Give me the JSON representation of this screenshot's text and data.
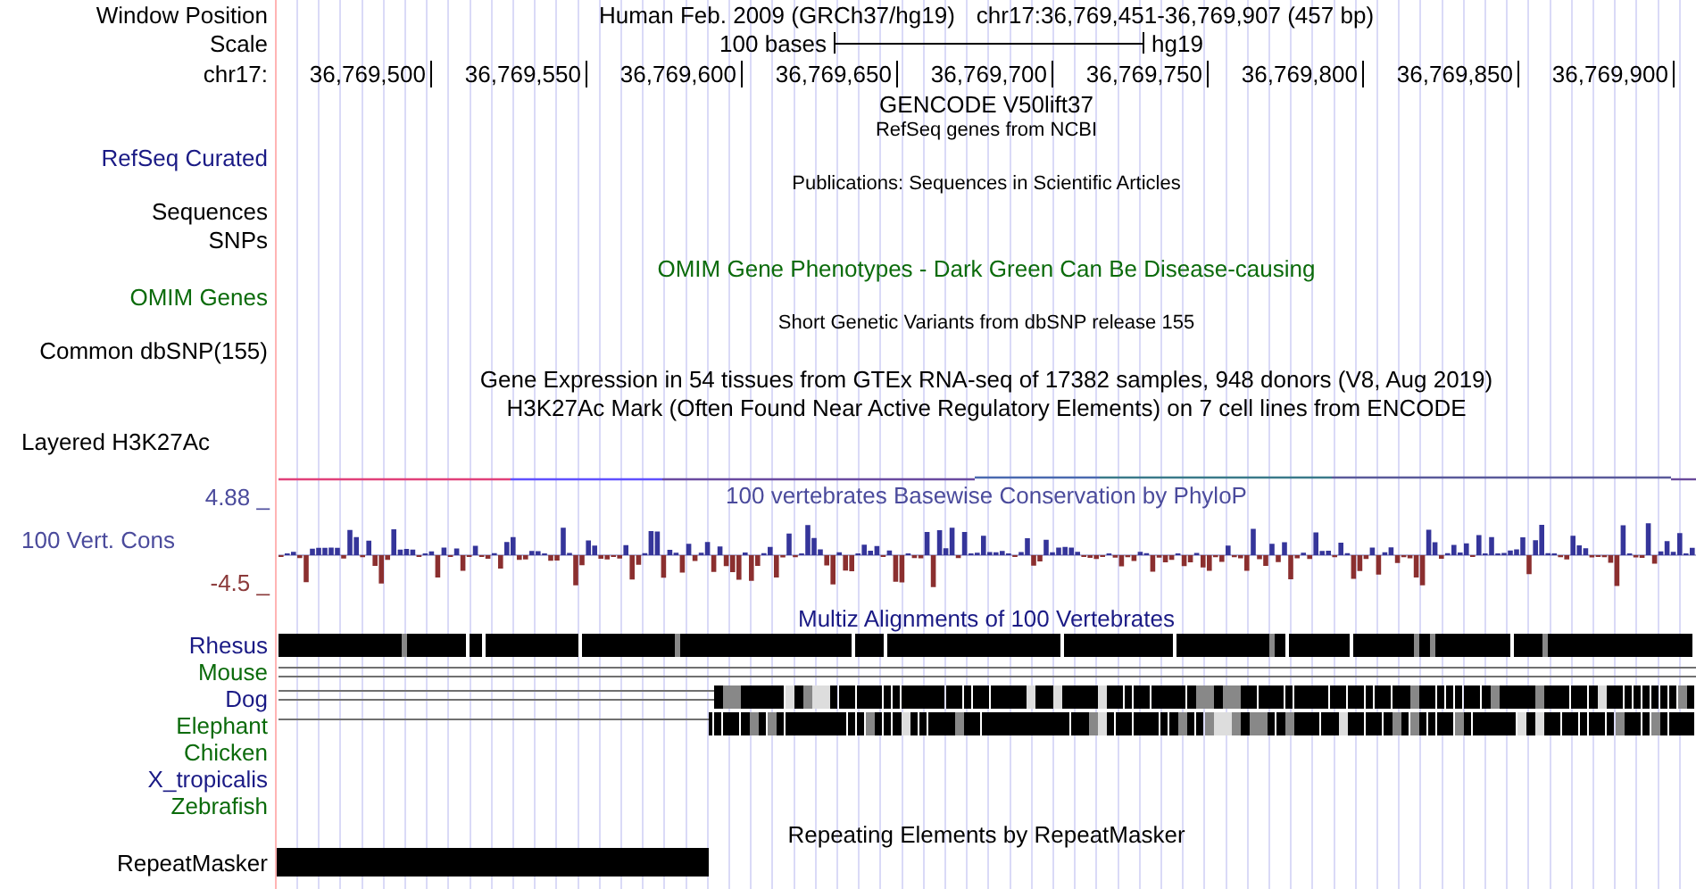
{
  "header": {
    "window_label": "Window Position",
    "assembly": "Human Feb. 2009 (GRCh37/hg19)",
    "position": "chr17:36,769,451-36,769,907 (457 bp)",
    "scale_label": "Scale",
    "scale_text": "100 bases",
    "scale_assembly": "hg19",
    "chrom_label": "chr17:",
    "ticks": [
      "36,769,500",
      "36,769,550",
      "36,769,600",
      "36,769,650",
      "36,769,700",
      "36,769,750",
      "36,769,800",
      "36,769,850",
      "36,769,900"
    ]
  },
  "tracks": [
    {
      "kind": "title",
      "text": "GENCODE V50lift37",
      "color": "#000000"
    },
    {
      "kind": "small_title",
      "text": "RefSeq genes from NCBI",
      "color": "#000000"
    },
    {
      "kind": "label",
      "label": "RefSeq Curated",
      "color": "#1a1a85"
    },
    {
      "kind": "small_title",
      "text": "Publications: Sequences in Scientific Articles",
      "color": "#000000"
    },
    {
      "kind": "label",
      "label": "Sequences",
      "color": "#000000"
    },
    {
      "kind": "label",
      "label": "SNPs",
      "color": "#000000"
    },
    {
      "kind": "title",
      "text": "OMIM Gene Phenotypes - Dark Green Can Be Disease-causing",
      "color": "#0b6b0b"
    },
    {
      "kind": "label",
      "label": "OMIM Genes",
      "color": "#0b6b0b"
    },
    {
      "kind": "small_title",
      "text": "Short Genetic Variants from dbSNP release 155",
      "color": "#000000"
    },
    {
      "kind": "label",
      "label": "Common dbSNP(155)",
      "color": "#000000"
    },
    {
      "kind": "title",
      "text": "Gene Expression in 54 tissues from GTEx RNA-seq of 17382 samples, 948 donors (V8, Aug 2019)",
      "color": "#000000"
    },
    {
      "kind": "title",
      "text": "H3K27Ac Mark (Often Found Near Active Regulatory Elements) on 7 cell lines from ENCODE",
      "color": "#000000"
    },
    {
      "kind": "label_left",
      "label": "Layered H3K27Ac",
      "color": "#000000"
    },
    {
      "kind": "signal_line"
    },
    {
      "kind": "conservation",
      "label": "100 Vert. Cons",
      "title": "100 vertebrates Basewise Conservation by PhyloP",
      "max": "4.88 _",
      "min": "-4.5 _",
      "color": "#4b4b9c"
    },
    {
      "kind": "title",
      "text": "Multiz Alignments of 100 Vertebrates",
      "color": "#1a1a85"
    },
    {
      "kind": "blocks",
      "label": "Rhesus",
      "color": "#1a1a85"
    },
    {
      "kind": "double_line",
      "label": "Mouse",
      "color": "#0b6b0b"
    },
    {
      "kind": "double_line_blocks",
      "label": "Dog",
      "color": "#1a1a85"
    },
    {
      "kind": "line_blocks",
      "label": "Elephant",
      "color": "#0b6b0b"
    },
    {
      "kind": "none",
      "label": "Chicken",
      "color": "#0b6b0b"
    },
    {
      "kind": "none",
      "label": "X_tropicalis",
      "color": "#1a1a85"
    },
    {
      "kind": "none",
      "label": "Zebrafish",
      "color": "#0b6b0b"
    },
    {
      "kind": "title",
      "text": "Repeating Elements by RepeatMasker",
      "color": "#000000"
    },
    {
      "kind": "repeat_bar",
      "label": "RepeatMasker",
      "color": "#000000"
    }
  ]
}
